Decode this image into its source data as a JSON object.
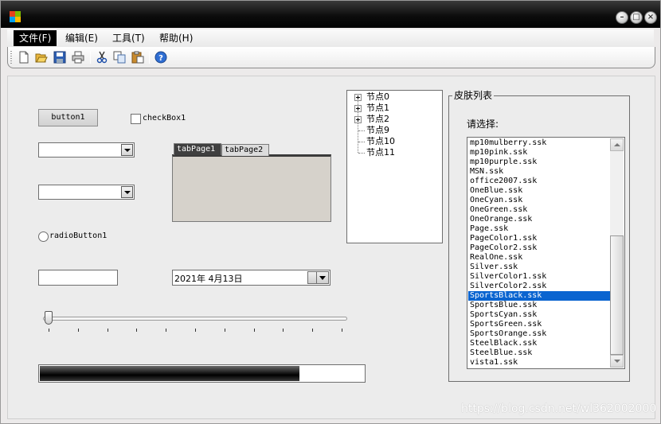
{
  "colors": {
    "titlebar": "#000000",
    "selection": "#0a64d0",
    "progress_fill": "#000000",
    "menu_active_bg": "#000000"
  },
  "window": {
    "icon": "app-icon",
    "controls": [
      "minimize-icon",
      "maximize-icon",
      "close-icon"
    ]
  },
  "menu": {
    "items": [
      {
        "label": "文件(F)",
        "active": true
      },
      {
        "label": "编辑(E)",
        "active": false
      },
      {
        "label": "工具(T)",
        "active": false
      },
      {
        "label": "帮助(H)",
        "active": false
      }
    ]
  },
  "toolbar": {
    "buttons": [
      "new-icon",
      "open-icon",
      "save-icon",
      "print-icon",
      "cut-icon",
      "copy-icon",
      "paste-icon",
      "help-icon"
    ]
  },
  "controls": {
    "button1_label": "button1",
    "checkbox1_label": "checkBox1",
    "checkbox1_checked": false,
    "radio1_label": "radioButton1",
    "radio1_checked": false,
    "combo1_value": "",
    "combo2_value": "",
    "textbox1_value": "",
    "date_value": "2021年  4月13日",
    "tabs": [
      "tabPage1",
      "tabPage2"
    ],
    "selected_tab": "tabPage1",
    "trackbar_value": 0,
    "trackbar_max": 10,
    "progress_fraction": 0.8
  },
  "tree": {
    "nodes": [
      {
        "label": "节点0",
        "expandable": true
      },
      {
        "label": "节点1",
        "expandable": true
      },
      {
        "label": "节点2",
        "expandable": true
      },
      {
        "label": "节点9",
        "expandable": false
      },
      {
        "label": "节点10",
        "expandable": false
      },
      {
        "label": "节点11",
        "expandable": false
      }
    ]
  },
  "skins": {
    "group_title": "皮肤列表",
    "prompt": "请选择:",
    "items": [
      "mp10mulberry.ssk",
      "mp10pink.ssk",
      "mp10purple.ssk",
      "MSN.ssk",
      "office2007.ssk",
      "OneBlue.ssk",
      "OneCyan.ssk",
      "OneGreen.ssk",
      "OneOrange.ssk",
      "Page.ssk",
      "PageColor1.ssk",
      "PageColor2.ssk",
      "RealOne.ssk",
      "Silver.ssk",
      "SilverColor1.ssk",
      "SilverColor2.ssk",
      "SportsBlack.ssk",
      "SportsBlue.ssk",
      "SportsCyan.ssk",
      "SportsGreen.ssk",
      "SportsOrange.ssk",
      "SteelBlack.ssk",
      "SteelBlue.ssk",
      "vista1.ssk"
    ],
    "selected": "SportsBlack.ssk"
  },
  "watermark": "https://blog.csdn.net/wl362002000"
}
